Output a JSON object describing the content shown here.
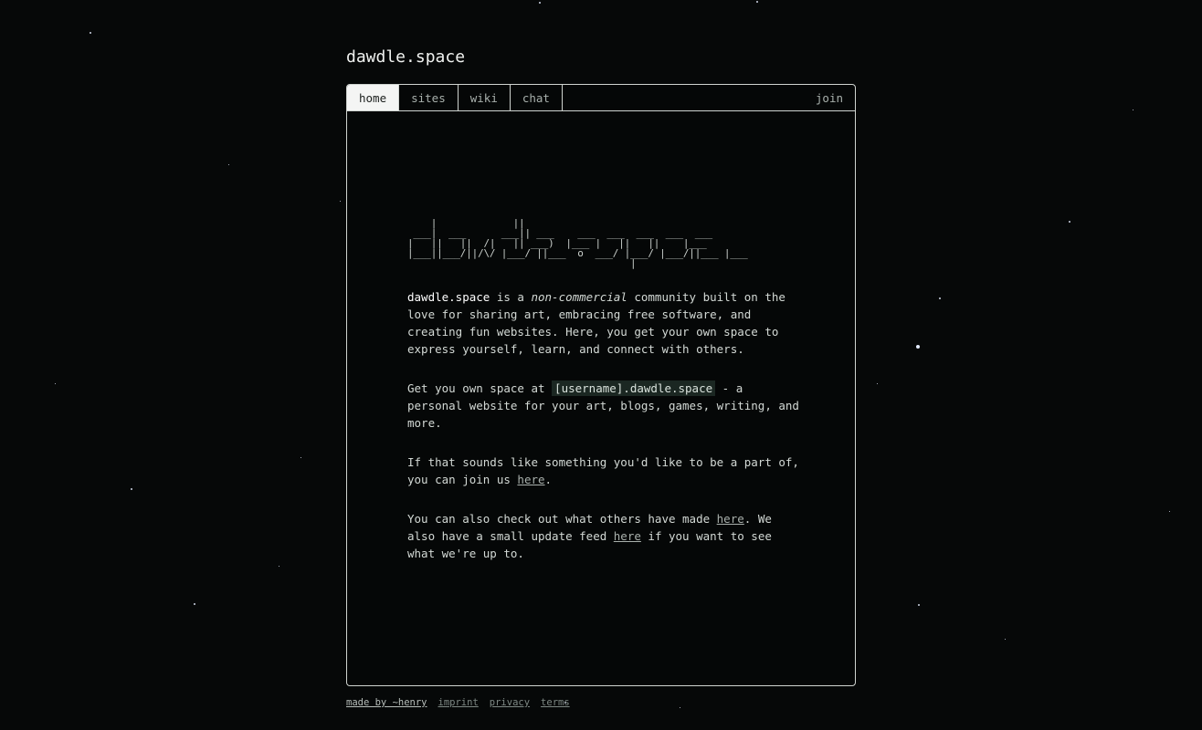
{
  "site_title": "dawdle.space",
  "tabs": [
    {
      "label": "home",
      "active": true
    },
    {
      "label": "sites",
      "active": false
    },
    {
      "label": "wiki",
      "active": false
    },
    {
      "label": "chat",
      "active": false
    }
  ],
  "join_label": "join",
  "ascii_logo": "    |             ||\n ___|  ___      ___|| ___    ___  ___  ___  ___  ___\n|   ||   ||  /|   || ___)  |___ |   ||   ||    |___\n|___||___/||/\\/ |___/ ||___  o  ___/ |___/ |___/||___ |___\n                                      |",
  "intro": {
    "brand": "dawdle.space",
    "part1": " is a ",
    "emphasis": "non-commercial",
    "part2": " community built on the love for sharing art, embracing free software, and creating fun websites. Here, you get your own space to express yourself, learn, and connect with others."
  },
  "own_space": {
    "before": "Get you own space at ",
    "code": "[username].dawdle.space",
    "after": " - a personal website for your art, blogs, games, writing, and more."
  },
  "join_para": {
    "before": "If that sounds like something you'd like to be a part of, you can join us ",
    "link": "here",
    "after": "."
  },
  "others_para": {
    "before": "You can also check out what others have made ",
    "link1": "here",
    "middle": ". We also have a small update feed ",
    "link2": "here",
    "after": " if you want to see what we're up to."
  },
  "footer": {
    "made_by": "made by ~henry",
    "imprint": "imprint",
    "privacy": "privacy",
    "terms": "terms"
  }
}
